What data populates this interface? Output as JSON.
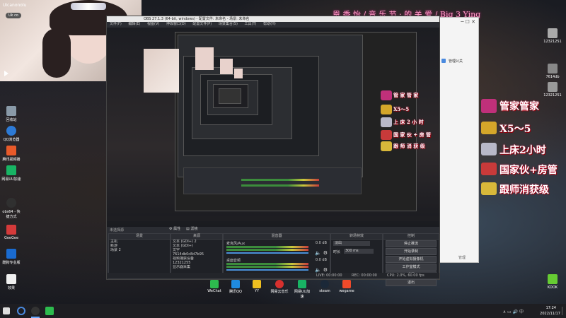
{
  "overlay_title": "恩 香 怡 / 音 乐 节 · 的 关 爱 / Big 3 Ying",
  "webcam": {
    "caption": "Uicanonolu",
    "badge": "Uk co"
  },
  "desktop_left": [
    {
      "label": "回收站"
    },
    {
      "label": "QQ浏览器"
    },
    {
      "label": "腾讯视频播"
    },
    {
      "label": "网易UU加速"
    },
    {
      "label": "obs64 - 快捷方式"
    },
    {
      "label": "GeeGee"
    },
    {
      "label": "酷狗专业版"
    },
    {
      "label": "效果"
    }
  ],
  "desktop_right": [
    {
      "label": "12321251"
    },
    {
      "label": "7614db"
    },
    {
      "label": "12321251"
    },
    {
      "label": "KOOK"
    }
  ],
  "obs": {
    "title": "OBS 27.1.3 (64-bit, windows) - 配置文件: 未命名 - 场景: 未命名",
    "menu": [
      "文件(F)",
      "编辑(E)",
      "视图(V)",
      "停靠窗口(D)",
      "配置文件(P)",
      "场景集合(S)",
      "工具(T)",
      "帮助(H)"
    ],
    "not_selected": "未选择源",
    "props_btn": "属性",
    "filter_btn": "滤镜",
    "scenes": {
      "header": "场景",
      "items": [
        "主机",
        "新游",
        "场景 2"
      ]
    },
    "sources": {
      "header": "来源",
      "items": [
        "文本 (GDI+) 2",
        "文本 (GDI+)",
        "文字",
        "7614db0c8d7b95",
        "视频捕获设备",
        "12321255",
        "显示器采集"
      ]
    },
    "mixer": {
      "header": "混音器",
      "ch1": "麦克风/Aux",
      "ch1_db": "0.0 dB",
      "ch2": "桌面音频",
      "ch2_db": "0.0 dB"
    },
    "transitions": {
      "header": "转场特效",
      "type": "淡出",
      "duration_label": "时长",
      "duration": "300 ms"
    },
    "controls": {
      "header": "控制",
      "buttons": [
        "停止推流",
        "开始录制",
        "开始虚拟摄像机",
        "工作室模式",
        "设置",
        "退出"
      ]
    },
    "status": {
      "live": "LIVE: 00:00:00",
      "rec": "REC: 00:00:00",
      "cpu": "CPU: 2.0%, 60.00 fps"
    }
  },
  "win2": {
    "item": "管理公关",
    "footer": "管理"
  },
  "stickers": {
    "small": [
      "管 家 管 家",
      "X5～5",
      "上 床 2 小 时",
      "国 家 伙 + 房 管",
      "跟 师 消 获 级"
    ],
    "large": [
      "管家管家",
      "X5～5",
      "上床2小时",
      "国家伙+房管",
      "跟师消获级"
    ]
  },
  "dock": [
    {
      "label": "WeChat"
    },
    {
      "label": "腾讯QQ"
    },
    {
      "label": "YY"
    },
    {
      "label": "网易云音乐"
    },
    {
      "label": "网易UU加速"
    },
    {
      "label": "steam"
    },
    {
      "label": "wegame"
    }
  ],
  "taskbar": {
    "time": "17:24",
    "date": "2022/11/17"
  },
  "colors": {
    "accent": "#d4336b",
    "obs_bg": "#2b2d33",
    "meter_green": "#3c8c3c"
  }
}
